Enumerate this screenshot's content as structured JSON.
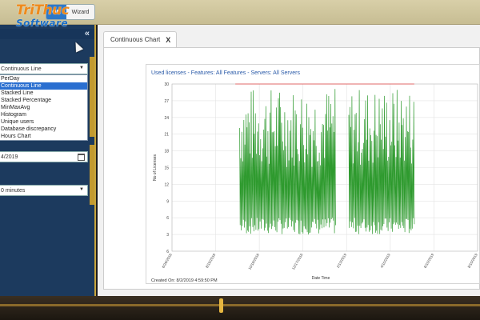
{
  "header": {
    "logo_main": "TriThuc",
    "logo_sub": "Software",
    "toggle_on": "ON",
    "toggle_wizard": "Wizard"
  },
  "sidebar": {
    "collapse_icon": "double-chevron-left-icon",
    "chart_type_value": "Continuous Line",
    "chart_type_options": [
      "PerDay",
      "Continuous Line",
      "Stacked Line",
      "Stacked Percentage",
      "MinMaxAvg",
      "Histogram",
      "Unique users",
      "Database discrepancy",
      "Hours Chart"
    ],
    "chart_type_selected_index": 1,
    "date_value": "4/2019",
    "interval_value": "0 minutes"
  },
  "main": {
    "tab_label": "Continuous Chart",
    "tab_close": "X"
  },
  "chart_data": {
    "type": "line",
    "title": "Used licenses - Features: All Features - Servers: All Servers",
    "xlabel": "Date Time",
    "ylabel": "No of Licenses",
    "ylim": [
      6,
      30
    ],
    "yticks": [
      6,
      3,
      6,
      9,
      12,
      15,
      18,
      21,
      24,
      27,
      30
    ],
    "ytick_labels": [
      "6",
      "3",
      "6",
      "9",
      "12",
      "15",
      "18",
      "21",
      "24",
      "27",
      "30"
    ],
    "xtick_labels": [
      "6/26/2016",
      "8/19/2016",
      "10/18/2016",
      "12/17/2016",
      "2/13/2019",
      "4/10/2019",
      "6/10/2019",
      "8/10/2019"
    ],
    "footer": "Created On: 8/2/2019 4:59:50 PM",
    "series": [
      {
        "color": "#2e9a2e",
        "segments": [
          {
            "x_start": 1.55,
            "x_end": 3.75
          },
          {
            "x_start": 4.05,
            "x_end": 5.55
          }
        ],
        "y_min": 3,
        "y_max": 29.5
      },
      {
        "color": "#e06a6a",
        "y_value": 30,
        "x_start": 1.45,
        "x_end": 5.55
      }
    ]
  }
}
